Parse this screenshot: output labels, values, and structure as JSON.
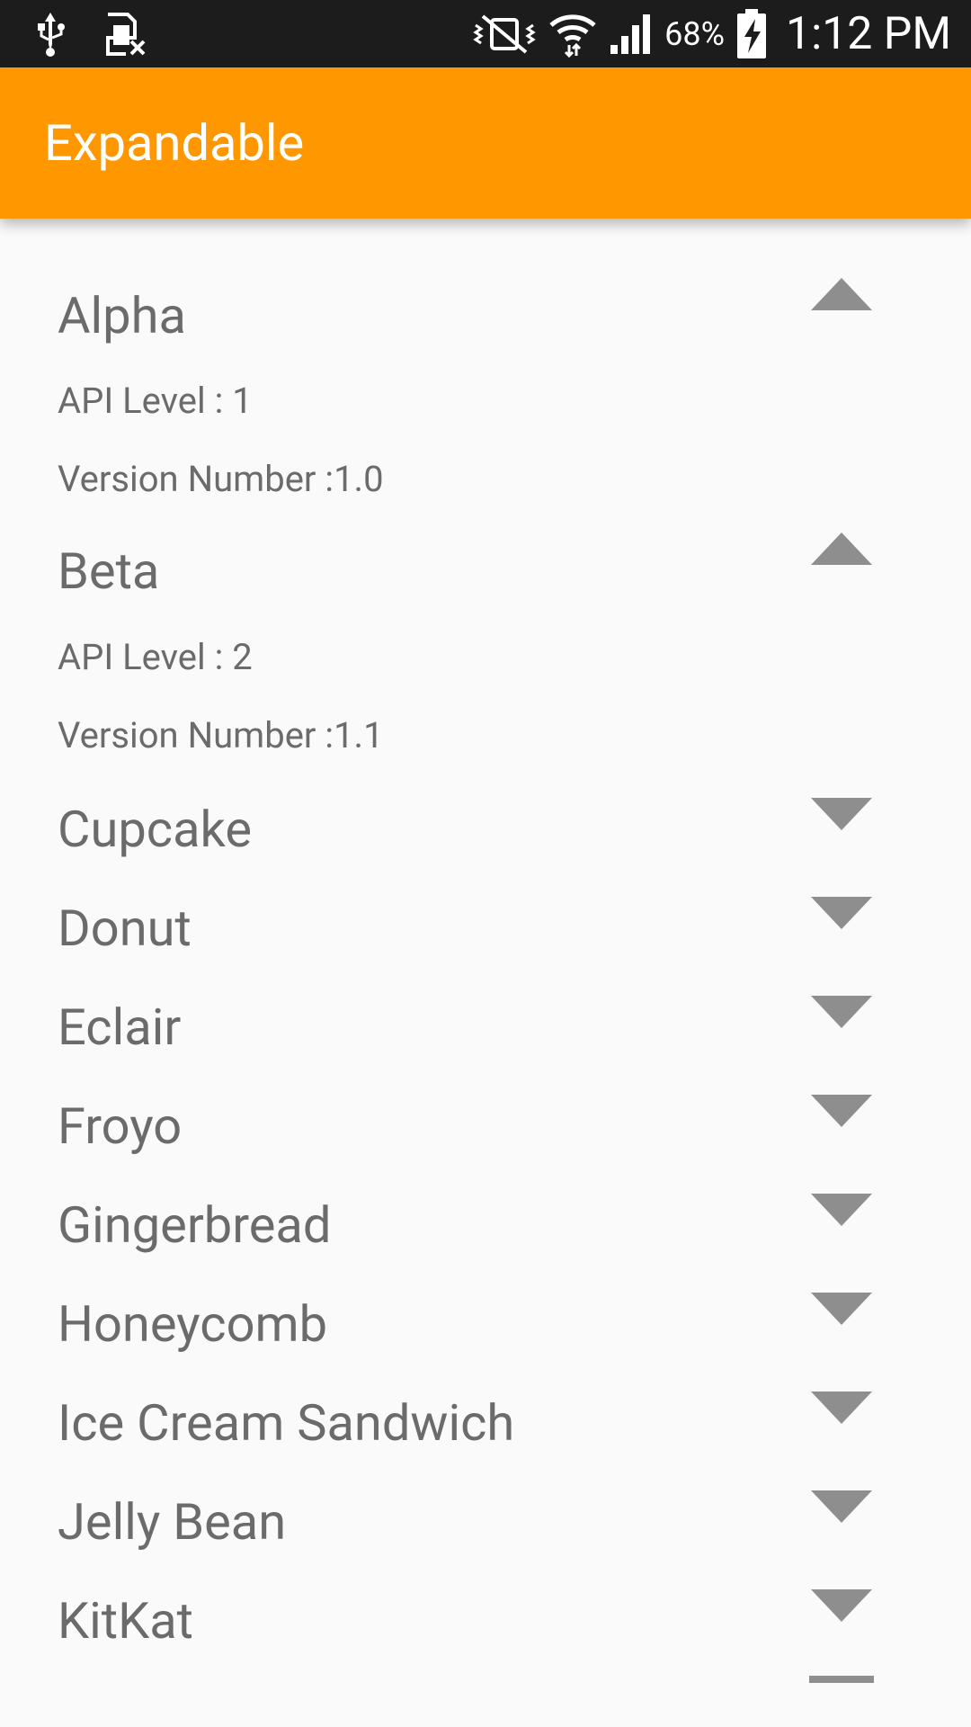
{
  "status_bar": {
    "battery_percent": "68%",
    "time": "1:12 PM",
    "icons": [
      "usb-icon",
      "sim-card-missing-icon",
      "vibrate-mute-icon",
      "wifi-icon",
      "signal-icon",
      "battery-charging-icon"
    ]
  },
  "app_bar": {
    "title": "Expandable",
    "color": "#ff9800"
  },
  "groups": [
    {
      "name": "Alpha",
      "expanded": true,
      "children": [
        "API Level : 1",
        "Version Number :1.0"
      ]
    },
    {
      "name": "Beta",
      "expanded": true,
      "children": [
        "API Level : 2",
        "Version Number :1.1"
      ]
    },
    {
      "name": "Cupcake",
      "expanded": false
    },
    {
      "name": "Donut",
      "expanded": false
    },
    {
      "name": "Eclair",
      "expanded": false
    },
    {
      "name": "Froyo",
      "expanded": false
    },
    {
      "name": "Gingerbread",
      "expanded": false
    },
    {
      "name": "Honeycomb",
      "expanded": false
    },
    {
      "name": "Ice Cream Sandwich",
      "expanded": false
    },
    {
      "name": "Jelly Bean",
      "expanded": false
    },
    {
      "name": "KitKat",
      "expanded": false
    }
  ],
  "colors": {
    "text": "#6b6b6b",
    "indicator": "#8e8e8e",
    "background": "#fafafa"
  }
}
